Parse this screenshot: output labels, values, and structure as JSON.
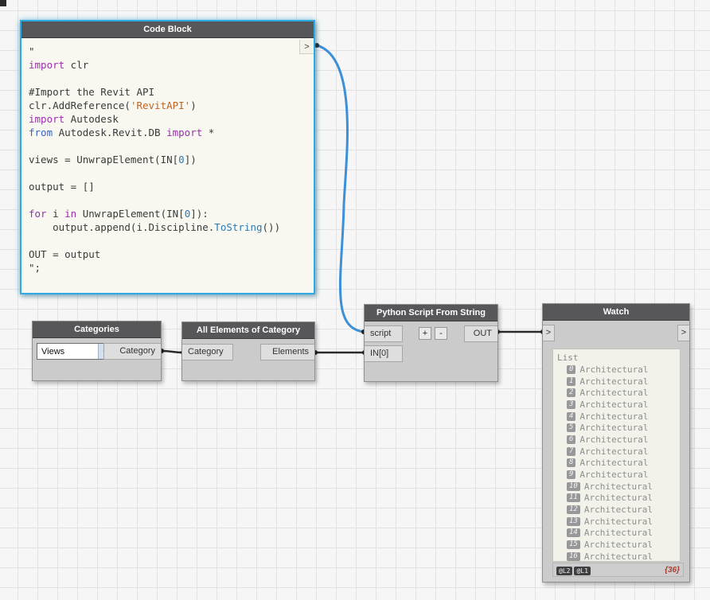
{
  "canvas": {
    "bg": "#f6f6f6",
    "grid_line": "#e2e2e2"
  },
  "colors": {
    "node_header_bg": "#57575a",
    "node_body_bg": "#cbcbcb",
    "port_bg": "#dedede",
    "selected_border": "#2fa9e1",
    "wire_selected": "#3d8fd6",
    "wire_default": "#2b2b2b",
    "code_block_bg": "#f8f8f1",
    "watch_list_bg": "#f2f2eb",
    "count_badge_color": "#b03a2e"
  },
  "icons": {
    "chevron_down": "▾"
  },
  "nodes": {
    "code_block": {
      "title": "Code Block",
      "output_port_label": ">",
      "code": [
        [
          {
            "t": "p",
            "v": "\""
          }
        ],
        [
          {
            "t": "k",
            "v": "import"
          },
          {
            "t": "p",
            "v": " clr"
          }
        ],
        [],
        [
          {
            "t": "p",
            "v": "#Import the Revit API"
          }
        ],
        [
          {
            "t": "p",
            "v": "clr.AddReference("
          },
          {
            "t": "s",
            "v": "'RevitAPI'"
          },
          {
            "t": "p",
            "v": ")"
          }
        ],
        [
          {
            "t": "k",
            "v": "import"
          },
          {
            "t": "p",
            "v": " Autodesk"
          }
        ],
        [
          {
            "t": "b",
            "v": "from"
          },
          {
            "t": "p",
            "v": " Autodesk.Revit.DB "
          },
          {
            "t": "k",
            "v": "import"
          },
          {
            "t": "p",
            "v": " *"
          }
        ],
        [],
        [
          {
            "t": "p",
            "v": "views = UnwrapElement(IN["
          },
          {
            "t": "n",
            "v": "0"
          },
          {
            "t": "p",
            "v": "])"
          }
        ],
        [],
        [
          {
            "t": "p",
            "v": "output = []"
          }
        ],
        [],
        [
          {
            "t": "k",
            "v": "for"
          },
          {
            "t": "p",
            "v": " i "
          },
          {
            "t": "k",
            "v": "in"
          },
          {
            "t": "p",
            "v": " UnwrapElement(IN["
          },
          {
            "t": "n",
            "v": "0"
          },
          {
            "t": "p",
            "v": "]):"
          }
        ],
        [
          {
            "t": "p",
            "v": "    output.append(i.Discipline."
          },
          {
            "t": "f",
            "v": "ToString"
          },
          {
            "t": "p",
            "v": "())"
          }
        ],
        [],
        [
          {
            "t": "p",
            "v": "OUT = output"
          }
        ],
        [
          {
            "t": "p",
            "v": "\";"
          }
        ]
      ]
    },
    "categories": {
      "title": "Categories",
      "dropdown_value": "Views",
      "output_label": "Category"
    },
    "all_elements_of_category": {
      "title": "All Elements of Category",
      "input_label": "Category",
      "output_label": "Elements"
    },
    "python_script": {
      "title": "Python Script From String",
      "input1_label": "script",
      "input2_label": "IN[0]",
      "add_label": "+",
      "remove_label": "-",
      "output_label": "OUT"
    },
    "watch": {
      "title": "Watch",
      "input_port_label": ">",
      "output_port_label": ">",
      "list_header": "List",
      "items": [
        {
          "index": "0",
          "value": "Architectural"
        },
        {
          "index": "1",
          "value": "Architectural"
        },
        {
          "index": "2",
          "value": "Architectural"
        },
        {
          "index": "3",
          "value": "Architectural"
        },
        {
          "index": "4",
          "value": "Architectural"
        },
        {
          "index": "5",
          "value": "Architectural"
        },
        {
          "index": "6",
          "value": "Architectural"
        },
        {
          "index": "7",
          "value": "Architectural"
        },
        {
          "index": "8",
          "value": "Architectural"
        },
        {
          "index": "9",
          "value": "Architectural"
        },
        {
          "index": "10",
          "value": "Architectural"
        },
        {
          "index": "11",
          "value": "Architectural"
        },
        {
          "index": "12",
          "value": "Architectural"
        },
        {
          "index": "13",
          "value": "Architectural"
        },
        {
          "index": "14",
          "value": "Architectural"
        },
        {
          "index": "15",
          "value": "Architectural"
        },
        {
          "index": "16",
          "value": "Architectural"
        }
      ],
      "level_tags": [
        "@L2",
        "@L1"
      ],
      "count_badge": "{36}"
    }
  }
}
